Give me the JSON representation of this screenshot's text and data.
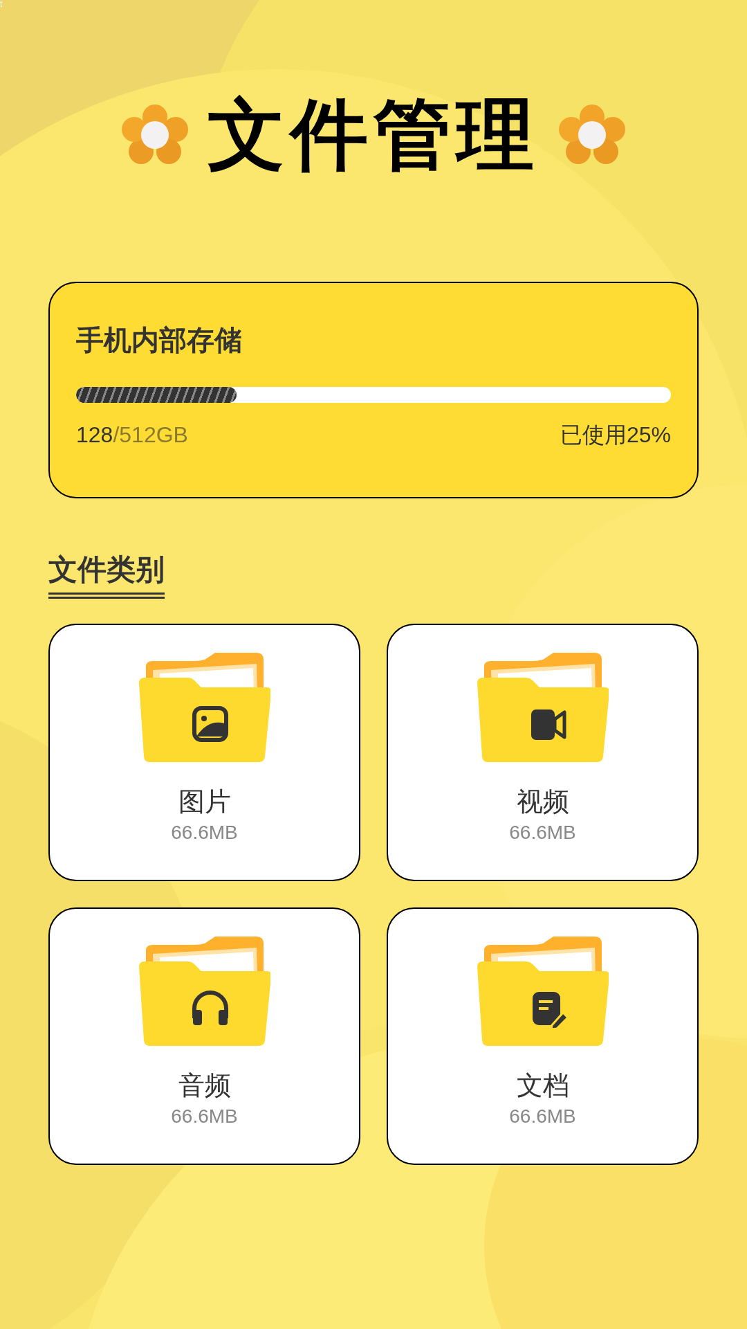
{
  "corner_text": "t",
  "title": "文件管理",
  "storage": {
    "title": "手机内部存储",
    "level": 0.27,
    "used": "128",
    "total": "/512GB",
    "percent": "已使用25%"
  },
  "section_title": "文件类别",
  "categories": [
    {
      "kind": "image",
      "name": "图片",
      "size": "66.6MB"
    },
    {
      "kind": "video",
      "name": "视频",
      "size": "66.6MB"
    },
    {
      "kind": "audio",
      "name": "音频",
      "size": "66.6MB"
    },
    {
      "kind": "document",
      "name": "文档",
      "size": "66.6MB"
    }
  ]
}
